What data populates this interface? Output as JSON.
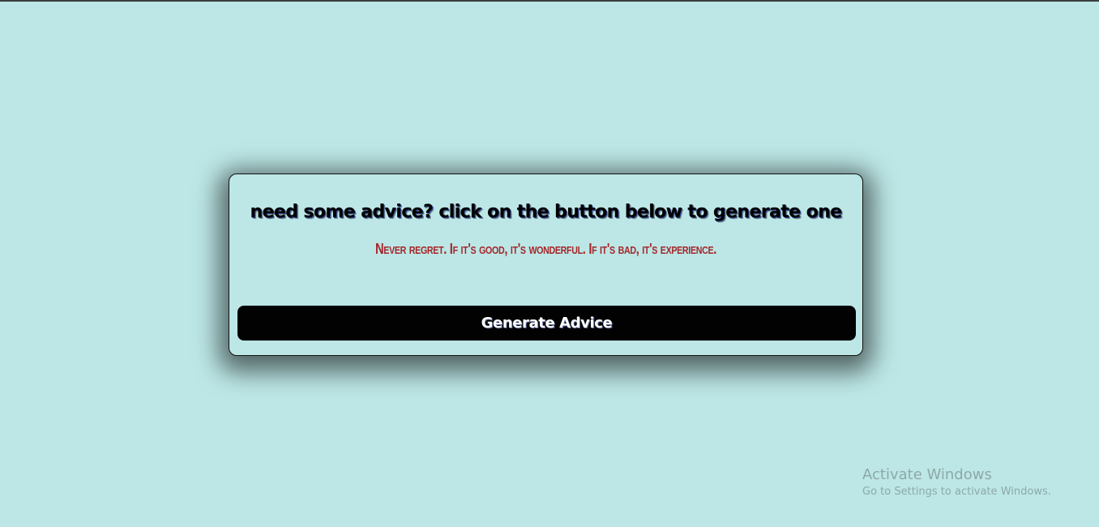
{
  "app": {
    "heading": "need some advice? click on the button below to generate one",
    "advice_text": "Never regret. If it's good, it's wonderful. If it's bad, it's experience.",
    "button_label": "Generate Advice"
  },
  "watermark": {
    "title": "Activate Windows",
    "subtitle": "Go to Settings to activate Windows."
  },
  "colors": {
    "background": "#bce7e6",
    "advice_text": "#a5262a",
    "button_bg": "#020202",
    "button_text": "#ffffff"
  }
}
